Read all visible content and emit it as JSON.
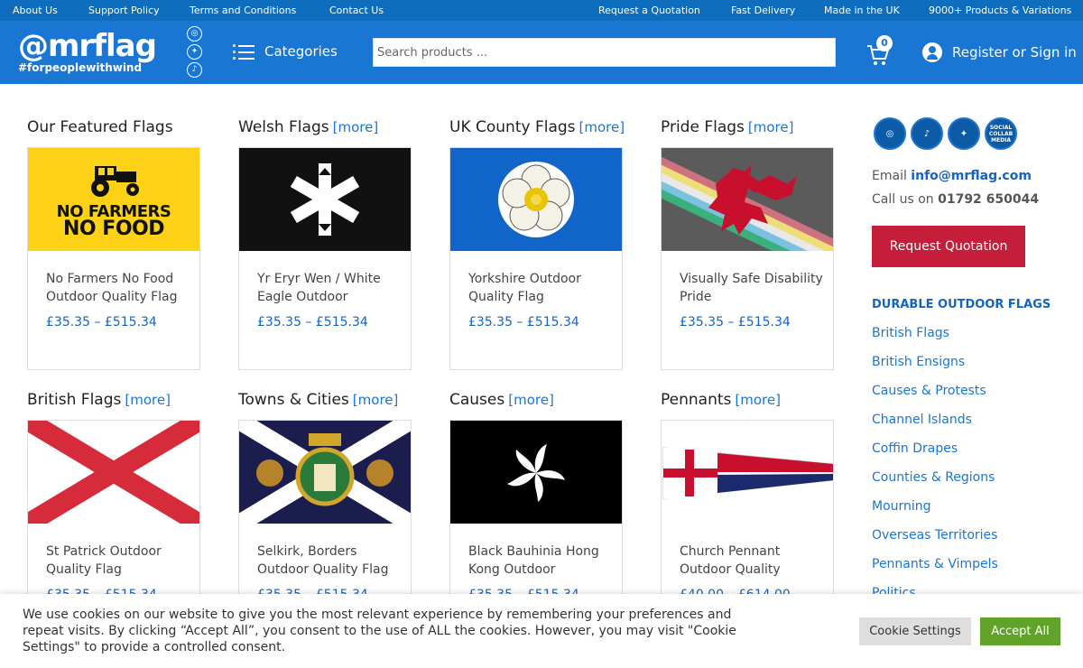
{
  "topbar": {
    "about": "About Us",
    "support": "Support Policy",
    "terms": "Terms and Conditions",
    "contact": "Contact Us",
    "quote": "Request a Quotation",
    "delivery": "Fast Delivery",
    "made": "Made in the UK",
    "products": "9000+ Products & Variations"
  },
  "header": {
    "logo_main": "@mrflag",
    "logo_tag": "#forpeoplewithwind",
    "categories_label": "Categories",
    "search_placeholder": "Search products ...",
    "cart_count": "0",
    "signin_label": "Register or Sign in"
  },
  "sections": [
    {
      "title": "Our Featured Flags",
      "more": "",
      "card": {
        "name": "No Farmers No Food Outdoor Quality Flag",
        "price": "£35.35 – £515.34",
        "flag_text_1": "NO FARMERS",
        "flag_text_2": "NO FOOD"
      }
    },
    {
      "title": "Welsh Flags",
      "more": "[more]",
      "card": {
        "name": "Yr Eryr Wen / White Eagle Outdoor",
        "price": "£35.35 – £515.34"
      }
    },
    {
      "title": "UK County Flags",
      "more": "[more]",
      "card": {
        "name": "Yorkshire Outdoor Quality Flag",
        "price": "£35.35 – £515.34"
      }
    },
    {
      "title": "Pride Flags",
      "more": "[more]",
      "card": {
        "name": "Visually Safe Disability Pride",
        "price": "£35.35 – £515.34"
      }
    },
    {
      "title": "British Flags",
      "more": "[more]",
      "card": {
        "name": "St Patrick Outdoor Quality Flag",
        "price": "£35.35 – £515.34"
      }
    },
    {
      "title": "Towns & Cities",
      "more": "[more]",
      "card": {
        "name": "Selkirk, Borders Outdoor Quality Flag",
        "price": "£35.35 – £515.34"
      }
    },
    {
      "title": "Causes",
      "more": "[more]",
      "card": {
        "name": "Black Bauhinia Hong Kong Outdoor",
        "price": "£35.35 – £515.34"
      }
    },
    {
      "title": "Pennants",
      "more": "[more]",
      "card": {
        "name": "Church Pennant Outdoor Quality",
        "price": "£40.00 – £614.00"
      }
    }
  ],
  "sidebar": {
    "socials": [
      "instagram-icon",
      "tiktok-icon",
      "twitter-icon",
      "social-collab-media-icon"
    ],
    "social_collab_label": "SOCIAL COLLAB MEDIA",
    "email_label": "Email",
    "email": "info@mrflag.com",
    "call_label": "Call us on",
    "phone": "01792 650044",
    "quote_button": "Request Quotation",
    "heading": "DURABLE OUTDOOR FLAGS",
    "links": [
      "British Flags",
      "British Ensigns",
      "Causes & Protests",
      "Channel Islands",
      "Coffin Drapes",
      "Counties & Regions",
      "Mourning",
      "Overseas Territories",
      "Pennants & Vimpels",
      "Politics"
    ]
  },
  "cookie": {
    "text": "We use cookies on our website to give you the most relevant experience by remembering your preferences and repeat visits. By clicking “Accept All”, you consent to the use of ALL the cookies. However, you may visit \"Cookie Settings\" to provide a controlled consent.",
    "settings_label": "Cookie Settings",
    "accept_label": "Accept All"
  },
  "colors": {
    "brand_blue": "#1976d2",
    "topbar_blue": "#0f6dbd",
    "quote_red": "#c41e3a",
    "accept_green": "#61a229"
  }
}
